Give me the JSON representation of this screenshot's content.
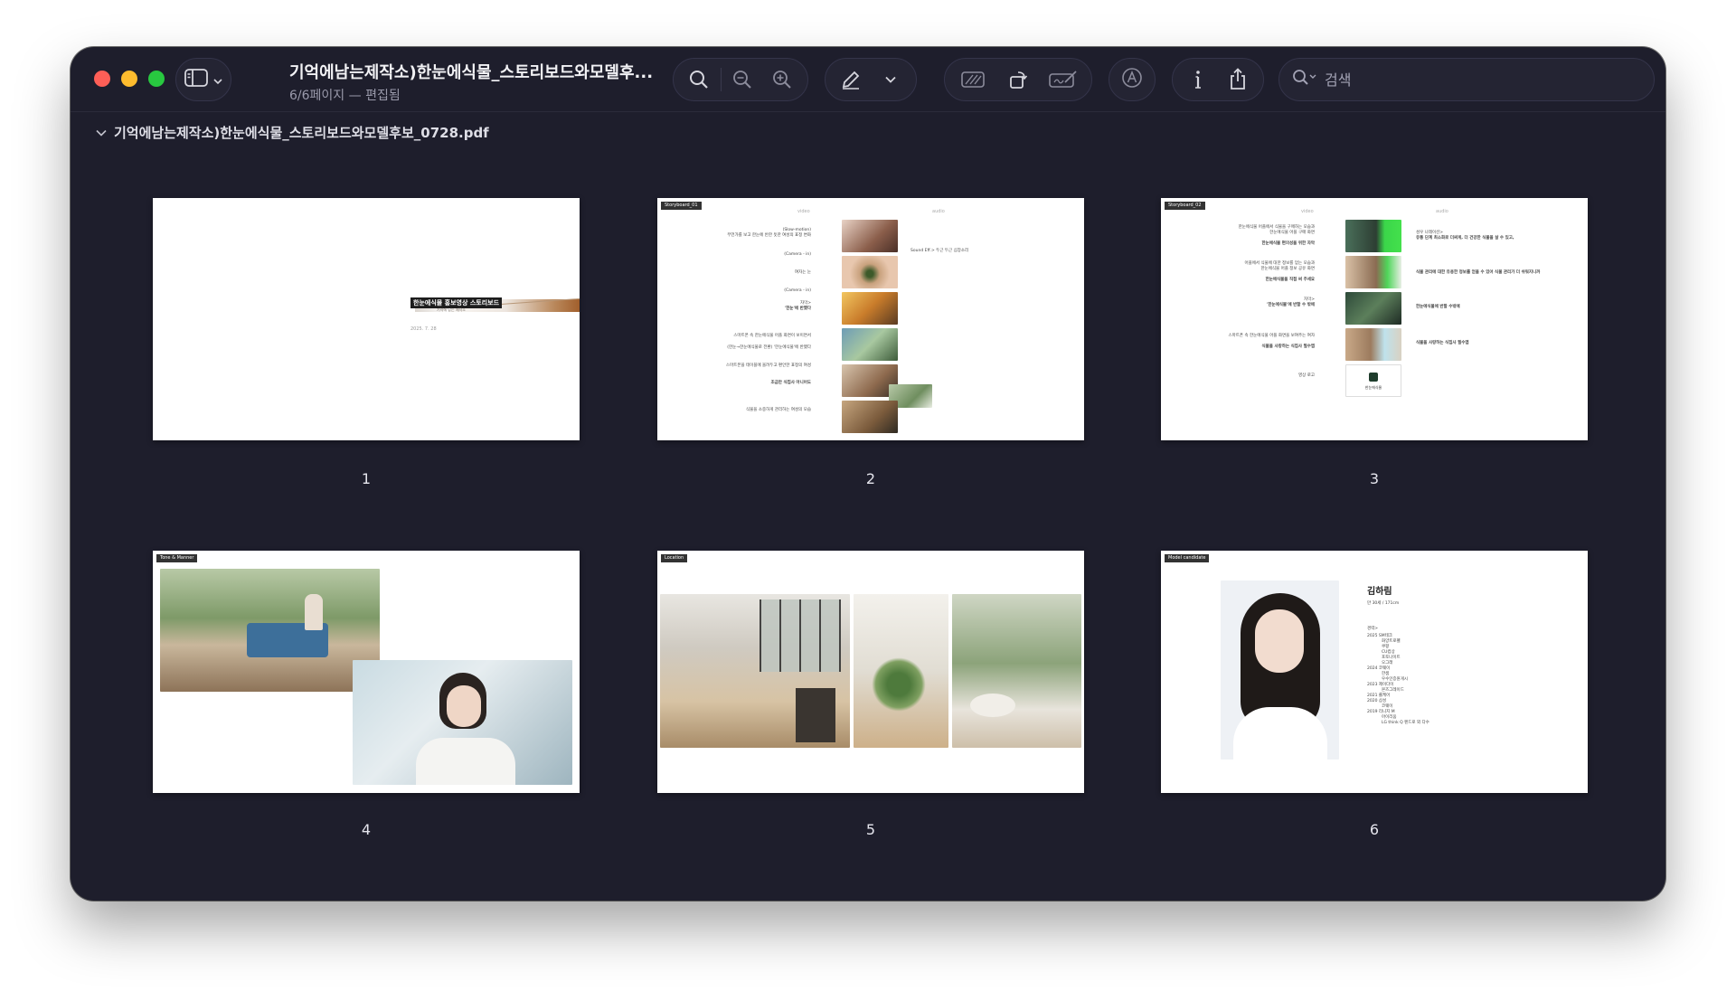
{
  "window": {
    "title": "기억에남는제작소)한눈에식물_스토리보드와모델후...",
    "subtitle": "6/6페이지 — 편집됨"
  },
  "search": {
    "placeholder": "검색"
  },
  "file": {
    "name": "기억에남는제작소)한눈에식물_스토리보드와모델후보_0728.pdf"
  },
  "icons": {
    "sidebar": "sidebar-icon",
    "zoom_fit": "magnifier-icon",
    "zoom_out": "zoom-out-icon",
    "zoom_in": "zoom-in-icon",
    "markup": "pencil-icon",
    "markup_menu": "chevron-down-icon",
    "redact": "redact-icon",
    "rotate": "rotate-icon",
    "sign": "signature-icon",
    "accessibility": "circle-a-icon",
    "info": "info-icon",
    "share": "share-icon",
    "search": "search-icon"
  },
  "pages": [
    {
      "number": "1",
      "title": "한눈에식물 홍보영상 스토리보드",
      "subtitle": "기억에 남는 제작소",
      "date": "2025. 7. 28"
    },
    {
      "number": "2",
      "tag": "Storyboard_01",
      "col_video": "video",
      "col_audio": "audio",
      "lines": [
        "(Slow-motion)",
        "무언가를 보고 한눈에 반한 듯한 여성의 표정 변화",
        "(Camera - in)",
        "여자는 눈",
        "(Camera - in)",
        "자막>",
        "'한눈'에 반했다",
        "스마트폰 속 한눈에식물 어플 화면이 보이면서",
        "(한눈→한눈에식물로 전환) '한눈에식물'에 반했다",
        "스마트폰을 테이블에 올려두고 편안한 표정의 여성",
        "조금만 식집사 아니어도",
        "식물을 소중하게 관리하는 여성의 모습"
      ],
      "audio_note": "Sound Eff.> 두근 두근 심장소리"
    },
    {
      "number": "3",
      "tag": "Storyboard_02",
      "col_video": "video",
      "col_audio": "audio",
      "lines": [
        "한눈에식물 어플에서 식물을 구매하는 모습과",
        "한눈에식물 어플 구매 화면",
        "한눈에식물 편의성을 위한 자막",
        "어플에서 식물에 대한 정보를 얻는 모습과",
        "한눈에식물 어플 정보 공유 화면",
        "한눈에식물을 직접 써 주세요",
        "자막>",
        "'한눈에식물'에 반할 수 밖에",
        "스마트폰 속 한눈에식물 어플 화면을 보여주는 여자",
        "식물을 사랑하는 식집사 필수앱",
        "영상 로고"
      ],
      "audio_lines": [
        "성우 나레이션>",
        "유통 단계 최소화로 더싸게, 더 건강한 식물을 살 수 있고,",
        "식물 관리에 대한 유용한 정보를 얻을 수 있어 식물 관리가 더 쉬워지니까",
        "한눈에식물에 반할 수밖에",
        "식물을 사랑하는 식집사 필수앱"
      ],
      "logo": "한눈에식물"
    },
    {
      "number": "4",
      "tag": "Tone & Manner"
    },
    {
      "number": "5",
      "tag": "Location"
    },
    {
      "number": "6",
      "tag": "Model candidate",
      "name": "김하림",
      "info": "만 30세 / 171cm",
      "career_label": "경력>",
      "career": [
        "2025 SM테크",
        "화양트로펠",
        "쿠팡",
        "CU컴상",
        "포토나이트",
        "오그래",
        "2024 코웨이",
        "한샘",
        "우수인증원게시",
        "2023 제이다이",
        "몬즈그레이드",
        "2021 롤케어",
        "2020 삼성",
        "코웨이",
        "2019 리니지 M",
        "아이리움",
        "LG think Q 펜드로 외 다수"
      ]
    }
  ]
}
